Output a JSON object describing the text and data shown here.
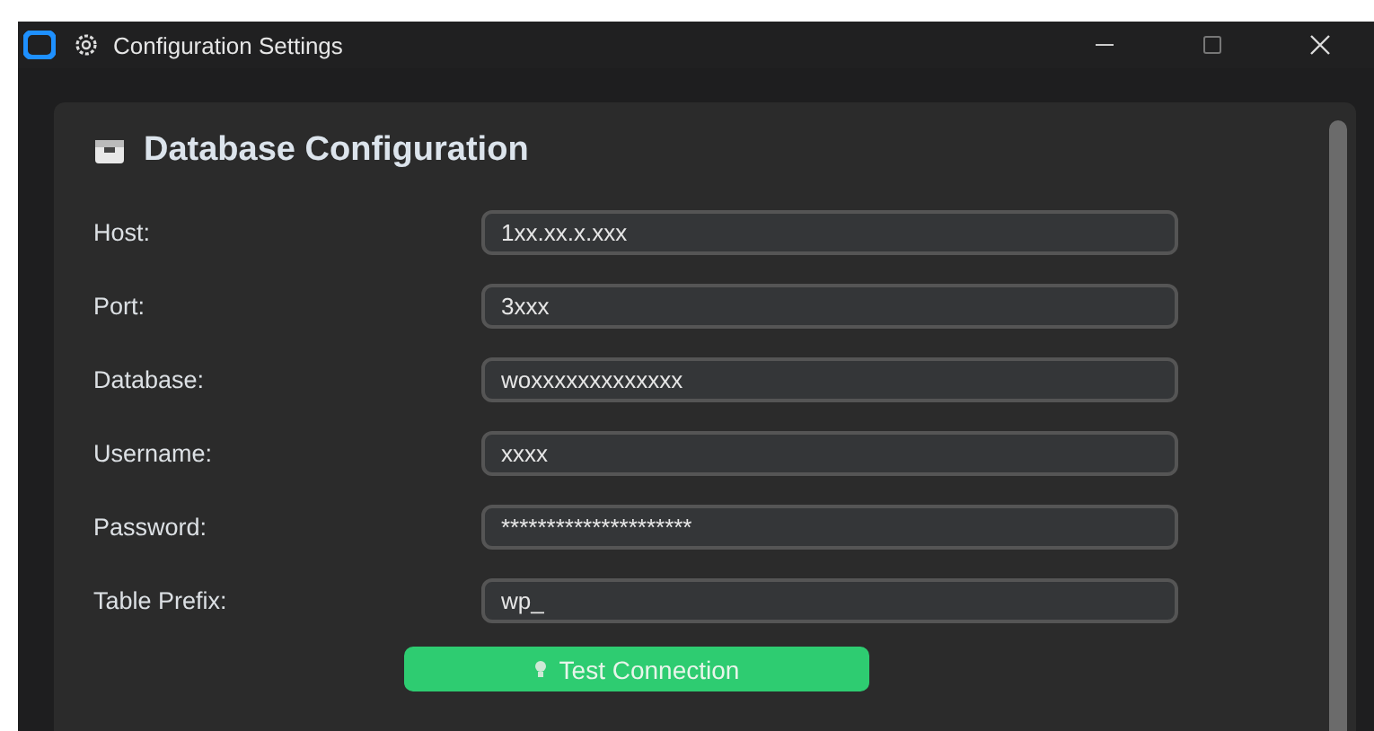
{
  "window": {
    "title": "Configuration Settings"
  },
  "section": {
    "title": "Database Configuration"
  },
  "fields": [
    {
      "label": "Host:",
      "value": "1xx.xx.x.xxx"
    },
    {
      "label": "Port:",
      "value": "3xxx"
    },
    {
      "label": "Database:",
      "value": "woxxxxxxxxxxxxx"
    },
    {
      "label": "Username:",
      "value": "xxxx"
    },
    {
      "label": "Password:",
      "value": "*********************"
    },
    {
      "label": "Table Prefix:",
      "value": "wp_"
    }
  ],
  "buttons": [
    {
      "label": "Test Connection"
    }
  ]
}
